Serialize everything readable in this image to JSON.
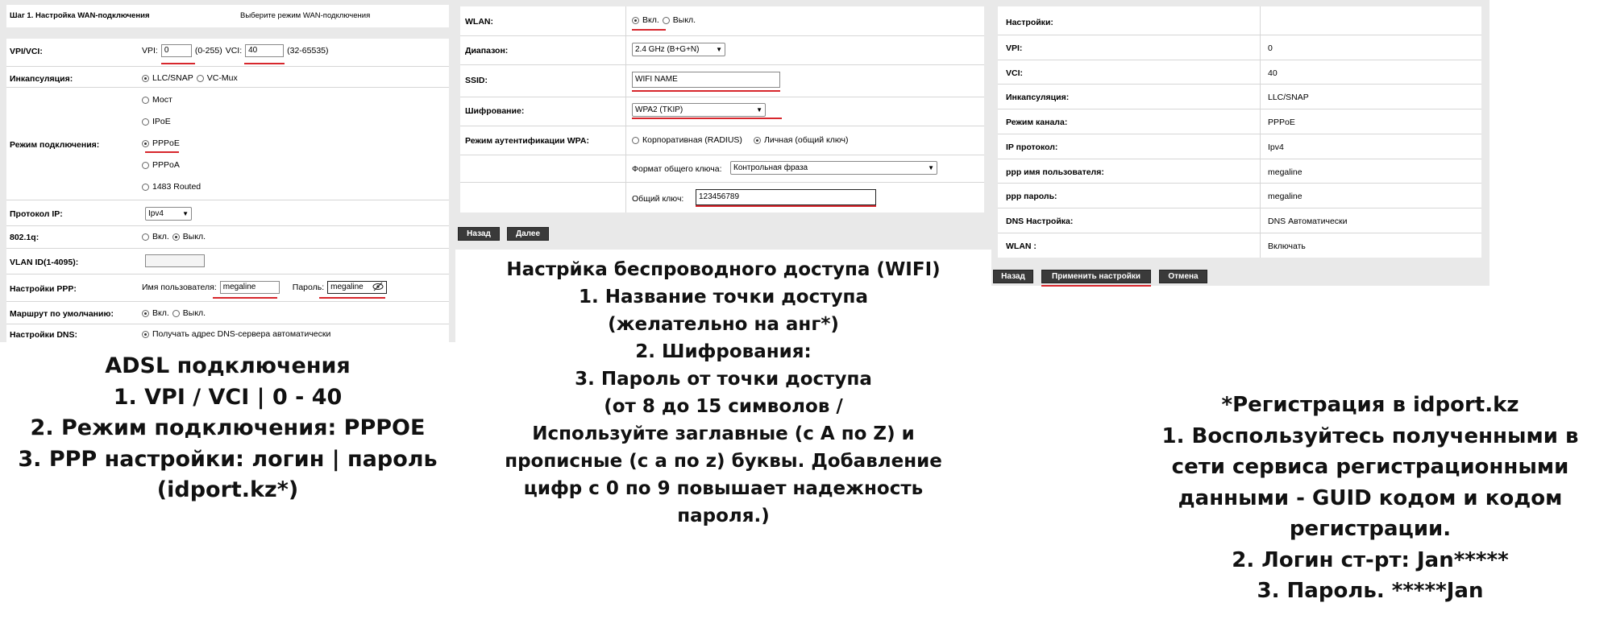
{
  "adsl": {
    "step_label": "Шаг 1. Настройка WAN-подключения",
    "step_value": "Выберите режим WAN-подключения",
    "vpivci_label": "VPI/VCI:",
    "vpi_prefix": "VPI:",
    "vpi_value": "0",
    "vpi_range": "(0-255)",
    "vci_prefix": "VCI:",
    "vci_value": "40",
    "vci_range": "(32-65535)",
    "encap_label": "Инкапсуляция:",
    "encap_opt1": "LLC/SNAP",
    "encap_opt2": "VC-Mux",
    "mode_label": "Режим подключения:",
    "mode_bridge": "Мост",
    "mode_ipoe": "IPoE",
    "mode_pppoe": "PPPoE",
    "mode_pppoa": "PPPoA",
    "mode_1483": "1483 Routed",
    "ip_proto_label": "Протокол IP:",
    "ip_proto_value": "Ipv4",
    "q_label": "802.1q:",
    "on": "Вкл.",
    "off": "Выкл.",
    "vlan_label": "VLAN ID(1-4095):",
    "ppp_label": "Настройки PPP:",
    "user_prefix": "Имя пользователя:",
    "user_value": "megaline",
    "pass_prefix": "Пароль:",
    "pass_value": "megaline",
    "route_label": "Маршрут по умолчанию:",
    "dns_label": "Настройки DNS:",
    "dns_value": "Получать адрес DNS-сервера автоматически"
  },
  "wlan": {
    "wlan_label": "WLAN:",
    "on": "Вкл.",
    "off": "Выкл.",
    "band_label": "Диапазон:",
    "band_value": "2.4 GHz (B+G+N)",
    "ssid_label": "SSID:",
    "ssid_value": "WIFI NAME",
    "cipher_label": "Шифрование:",
    "cipher_value": "WPA2 (TKIP)",
    "auth_label": "Режим аутентификации WPA:",
    "auth_opt1": "Корпоративная (RADIUS)",
    "auth_opt2": "Личная (общий ключ)",
    "key_format_label": "Формат общего ключа:",
    "key_format_value": "Контрольная фраза",
    "key_label": "Общий ключ:",
    "key_value": "123456789",
    "back_button": "Назад",
    "next_button": "Далее"
  },
  "summary": {
    "header": "Настройки:",
    "rows": [
      {
        "label": "VPI:",
        "value": "0"
      },
      {
        "label": "VCI:",
        "value": "40"
      },
      {
        "label": "Инкапсуляция:",
        "value": "LLC/SNAP"
      },
      {
        "label": "Режим канала:",
        "value": "PPPoE"
      },
      {
        "label": "IP протокол:",
        "value": "Ipv4"
      },
      {
        "label": "ppp имя пользователя:",
        "value": "megaline"
      },
      {
        "label": "ppp пароль:",
        "value": "megaline"
      },
      {
        "label": "DNS Настройка:",
        "value": "DNS Автоматически"
      },
      {
        "label": "WLAN :",
        "value": "Включать"
      }
    ],
    "back_button": "Назад",
    "apply_button": "Применить настройки",
    "cancel_button": "Отмена"
  },
  "captions": {
    "adsl": [
      "ADSL подключения",
      "1. VPI / VCI | 0 - 40",
      "2. Режим подключения: PPPOE",
      "3. PPP настройки: логин | пароль",
      "(idport.kz*)"
    ],
    "wifi": [
      "Настрйка беспроводного доступа (WIFI)",
      "1. Название точки доступа",
      "(желательно на анг*)",
      "2. Шифрования:",
      "3. Пароль от точки доступа",
      "(от 8 до 15 символов /",
      "Используйте заглавные (с A по Z) и",
      "прописные (с a по z) буквы. Добавление",
      "цифр с 0 по 9 повышает надежность",
      "пароля.)"
    ],
    "reg": [
      "*Регистрация в idport.kz",
      "1. Воспользуйтесь полученными в",
      "сети сервиса регистрационными",
      "данными - GUID кодом и кодом",
      "регистрации.",
      "2. Логин ст-рт: Jan*****",
      "3. Пароль. *****Jan"
    ]
  },
  "colors": {
    "accent_red": "#d7262c",
    "panel_bg": "#e9e9e9",
    "button_bg": "#3a3a3a"
  }
}
